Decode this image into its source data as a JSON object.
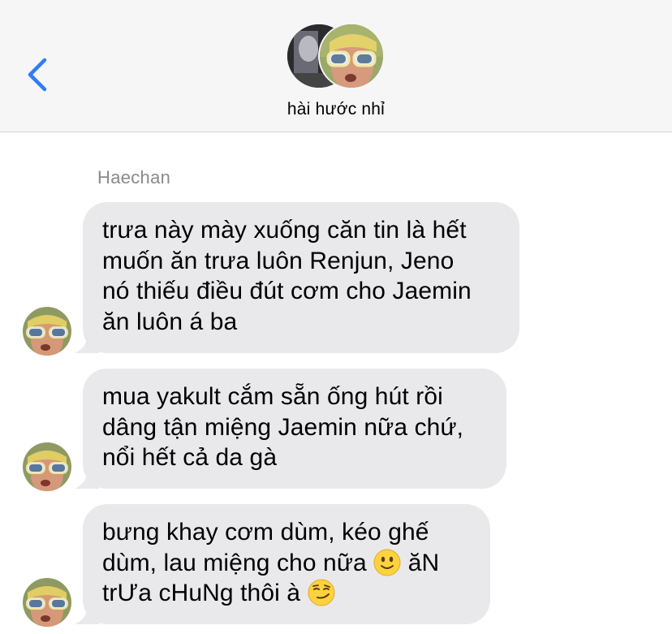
{
  "header": {
    "title": "hài hước nhỉ",
    "back_icon": "chevron-left-icon",
    "accent": "#2f7cf6"
  },
  "thread": {
    "sender": "Haechan",
    "messages": [
      {
        "text": "trưa này mày xuống căn tin là hết\nmuốn ăn trưa luôn Renjun, Jeno\nnó thiếu điều đút cơm cho Jaemin\năn luôn á ba"
      },
      {
        "text": "mua yakult cắm sẵn ống hút rồi\ndâng tận miệng Jaemin nữa chứ,\nnổi hết cả da gà"
      },
      {
        "text_line1": "bưng khay cơm dùm, kéo ghế",
        "text_line2": "dùm, lau miệng cho nữa",
        "text_line2b": "ăN",
        "text_line3": "trƯa cHuNg thôi à",
        "emoji1": "slightly-smiling-face",
        "emoji2": "smirking-face"
      }
    ]
  },
  "colors": {
    "bubble": "#e9e9eb",
    "header_bg": "#f6f6f6",
    "sender_name": "#8a8a8e"
  }
}
